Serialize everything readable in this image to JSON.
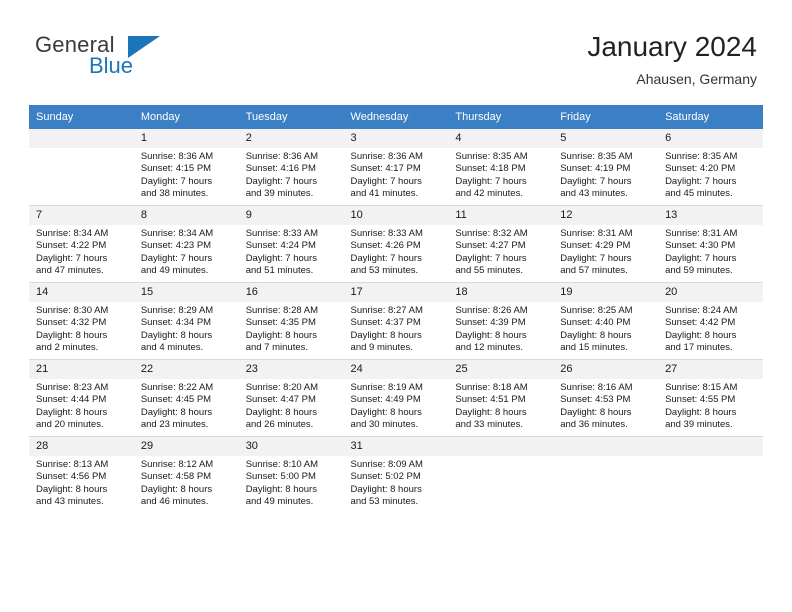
{
  "brand": {
    "word_general": "General",
    "word_blue": "Blue",
    "flag_icon": "triangle-flag-icon",
    "accent_color": "#1b75bb"
  },
  "header": {
    "title": "January 2024",
    "location": "Ahausen, Germany"
  },
  "calendar": {
    "header_bg": "#3b7fc4",
    "daynum_bg": "#f2f2f2",
    "weekday_headers": [
      "Sunday",
      "Monday",
      "Tuesday",
      "Wednesday",
      "Thursday",
      "Friday",
      "Saturday"
    ],
    "weeks": [
      [
        {
          "day": "",
          "sunrise": "",
          "sunset": "",
          "daylight_line1": "",
          "daylight_line2": "",
          "blank": true
        },
        {
          "day": "1",
          "sunrise": "Sunrise: 8:36 AM",
          "sunset": "Sunset: 4:15 PM",
          "daylight_line1": "Daylight: 7 hours",
          "daylight_line2": "and 38 minutes."
        },
        {
          "day": "2",
          "sunrise": "Sunrise: 8:36 AM",
          "sunset": "Sunset: 4:16 PM",
          "daylight_line1": "Daylight: 7 hours",
          "daylight_line2": "and 39 minutes."
        },
        {
          "day": "3",
          "sunrise": "Sunrise: 8:36 AM",
          "sunset": "Sunset: 4:17 PM",
          "daylight_line1": "Daylight: 7 hours",
          "daylight_line2": "and 41 minutes."
        },
        {
          "day": "4",
          "sunrise": "Sunrise: 8:35 AM",
          "sunset": "Sunset: 4:18 PM",
          "daylight_line1": "Daylight: 7 hours",
          "daylight_line2": "and 42 minutes."
        },
        {
          "day": "5",
          "sunrise": "Sunrise: 8:35 AM",
          "sunset": "Sunset: 4:19 PM",
          "daylight_line1": "Daylight: 7 hours",
          "daylight_line2": "and 43 minutes."
        },
        {
          "day": "6",
          "sunrise": "Sunrise: 8:35 AM",
          "sunset": "Sunset: 4:20 PM",
          "daylight_line1": "Daylight: 7 hours",
          "daylight_line2": "and 45 minutes."
        }
      ],
      [
        {
          "day": "7",
          "sunrise": "Sunrise: 8:34 AM",
          "sunset": "Sunset: 4:22 PM",
          "daylight_line1": "Daylight: 7 hours",
          "daylight_line2": "and 47 minutes."
        },
        {
          "day": "8",
          "sunrise": "Sunrise: 8:34 AM",
          "sunset": "Sunset: 4:23 PM",
          "daylight_line1": "Daylight: 7 hours",
          "daylight_line2": "and 49 minutes."
        },
        {
          "day": "9",
          "sunrise": "Sunrise: 8:33 AM",
          "sunset": "Sunset: 4:24 PM",
          "daylight_line1": "Daylight: 7 hours",
          "daylight_line2": "and 51 minutes."
        },
        {
          "day": "10",
          "sunrise": "Sunrise: 8:33 AM",
          "sunset": "Sunset: 4:26 PM",
          "daylight_line1": "Daylight: 7 hours",
          "daylight_line2": "and 53 minutes."
        },
        {
          "day": "11",
          "sunrise": "Sunrise: 8:32 AM",
          "sunset": "Sunset: 4:27 PM",
          "daylight_line1": "Daylight: 7 hours",
          "daylight_line2": "and 55 minutes."
        },
        {
          "day": "12",
          "sunrise": "Sunrise: 8:31 AM",
          "sunset": "Sunset: 4:29 PM",
          "daylight_line1": "Daylight: 7 hours",
          "daylight_line2": "and 57 minutes."
        },
        {
          "day": "13",
          "sunrise": "Sunrise: 8:31 AM",
          "sunset": "Sunset: 4:30 PM",
          "daylight_line1": "Daylight: 7 hours",
          "daylight_line2": "and 59 minutes."
        }
      ],
      [
        {
          "day": "14",
          "sunrise": "Sunrise: 8:30 AM",
          "sunset": "Sunset: 4:32 PM",
          "daylight_line1": "Daylight: 8 hours",
          "daylight_line2": "and 2 minutes."
        },
        {
          "day": "15",
          "sunrise": "Sunrise: 8:29 AM",
          "sunset": "Sunset: 4:34 PM",
          "daylight_line1": "Daylight: 8 hours",
          "daylight_line2": "and 4 minutes."
        },
        {
          "day": "16",
          "sunrise": "Sunrise: 8:28 AM",
          "sunset": "Sunset: 4:35 PM",
          "daylight_line1": "Daylight: 8 hours",
          "daylight_line2": "and 7 minutes."
        },
        {
          "day": "17",
          "sunrise": "Sunrise: 8:27 AM",
          "sunset": "Sunset: 4:37 PM",
          "daylight_line1": "Daylight: 8 hours",
          "daylight_line2": "and 9 minutes."
        },
        {
          "day": "18",
          "sunrise": "Sunrise: 8:26 AM",
          "sunset": "Sunset: 4:39 PM",
          "daylight_line1": "Daylight: 8 hours",
          "daylight_line2": "and 12 minutes."
        },
        {
          "day": "19",
          "sunrise": "Sunrise: 8:25 AM",
          "sunset": "Sunset: 4:40 PM",
          "daylight_line1": "Daylight: 8 hours",
          "daylight_line2": "and 15 minutes."
        },
        {
          "day": "20",
          "sunrise": "Sunrise: 8:24 AM",
          "sunset": "Sunset: 4:42 PM",
          "daylight_line1": "Daylight: 8 hours",
          "daylight_line2": "and 17 minutes."
        }
      ],
      [
        {
          "day": "21",
          "sunrise": "Sunrise: 8:23 AM",
          "sunset": "Sunset: 4:44 PM",
          "daylight_line1": "Daylight: 8 hours",
          "daylight_line2": "and 20 minutes."
        },
        {
          "day": "22",
          "sunrise": "Sunrise: 8:22 AM",
          "sunset": "Sunset: 4:45 PM",
          "daylight_line1": "Daylight: 8 hours",
          "daylight_line2": "and 23 minutes."
        },
        {
          "day": "23",
          "sunrise": "Sunrise: 8:20 AM",
          "sunset": "Sunset: 4:47 PM",
          "daylight_line1": "Daylight: 8 hours",
          "daylight_line2": "and 26 minutes."
        },
        {
          "day": "24",
          "sunrise": "Sunrise: 8:19 AM",
          "sunset": "Sunset: 4:49 PM",
          "daylight_line1": "Daylight: 8 hours",
          "daylight_line2": "and 30 minutes."
        },
        {
          "day": "25",
          "sunrise": "Sunrise: 8:18 AM",
          "sunset": "Sunset: 4:51 PM",
          "daylight_line1": "Daylight: 8 hours",
          "daylight_line2": "and 33 minutes."
        },
        {
          "day": "26",
          "sunrise": "Sunrise: 8:16 AM",
          "sunset": "Sunset: 4:53 PM",
          "daylight_line1": "Daylight: 8 hours",
          "daylight_line2": "and 36 minutes."
        },
        {
          "day": "27",
          "sunrise": "Sunrise: 8:15 AM",
          "sunset": "Sunset: 4:55 PM",
          "daylight_line1": "Daylight: 8 hours",
          "daylight_line2": "and 39 minutes."
        }
      ],
      [
        {
          "day": "28",
          "sunrise": "Sunrise: 8:13 AM",
          "sunset": "Sunset: 4:56 PM",
          "daylight_line1": "Daylight: 8 hours",
          "daylight_line2": "and 43 minutes."
        },
        {
          "day": "29",
          "sunrise": "Sunrise: 8:12 AM",
          "sunset": "Sunset: 4:58 PM",
          "daylight_line1": "Daylight: 8 hours",
          "daylight_line2": "and 46 minutes."
        },
        {
          "day": "30",
          "sunrise": "Sunrise: 8:10 AM",
          "sunset": "Sunset: 5:00 PM",
          "daylight_line1": "Daylight: 8 hours",
          "daylight_line2": "and 49 minutes."
        },
        {
          "day": "31",
          "sunrise": "Sunrise: 8:09 AM",
          "sunset": "Sunset: 5:02 PM",
          "daylight_line1": "Daylight: 8 hours",
          "daylight_line2": "and 53 minutes."
        },
        {
          "day": "",
          "sunrise": "",
          "sunset": "",
          "daylight_line1": "",
          "daylight_line2": "",
          "blank": true
        },
        {
          "day": "",
          "sunrise": "",
          "sunset": "",
          "daylight_line1": "",
          "daylight_line2": "",
          "blank": true
        },
        {
          "day": "",
          "sunrise": "",
          "sunset": "",
          "daylight_line1": "",
          "daylight_line2": "",
          "blank": true
        }
      ]
    ]
  }
}
